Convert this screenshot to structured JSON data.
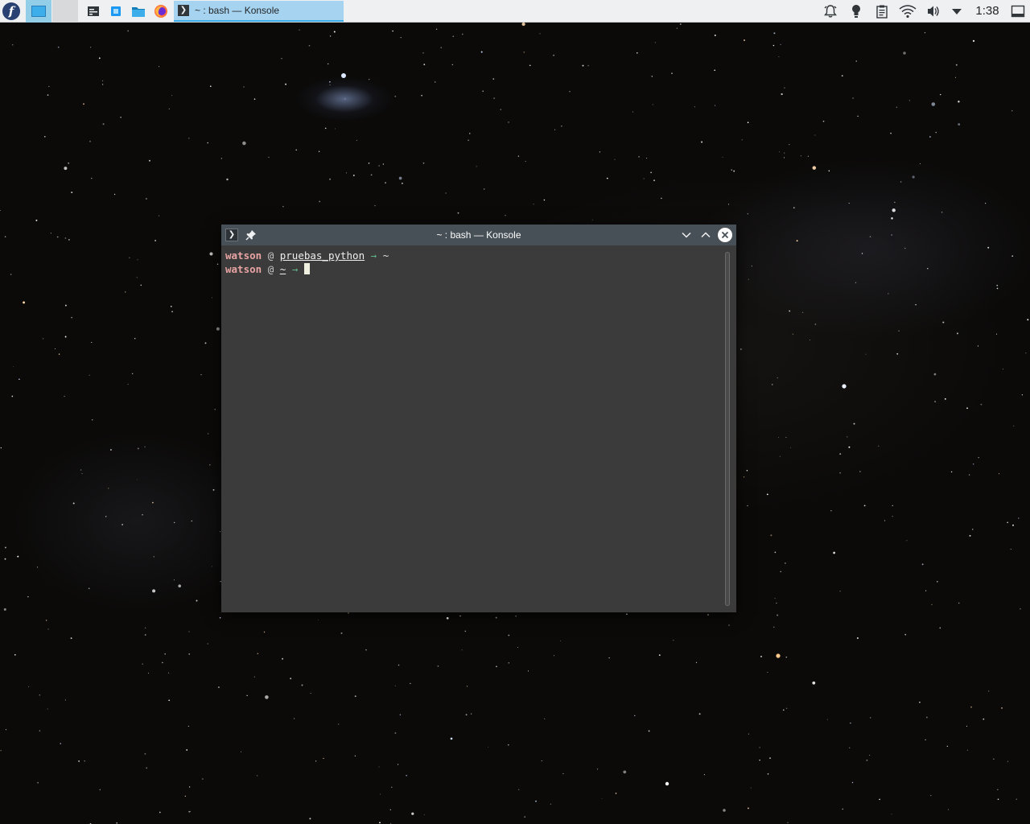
{
  "panel": {
    "launcher_icon": "fedora-logo-icon",
    "launcher_glyph": "f",
    "desktops": [
      {
        "icon": "virtual-desktop-1-icon",
        "active": true
      },
      {
        "icon": "virtual-desktop-2-icon",
        "active": false
      }
    ],
    "quick_launch": [
      {
        "icon": "system-settings-icon"
      },
      {
        "icon": "discover-icon"
      },
      {
        "icon": "dolphin-folder-icon"
      },
      {
        "icon": "firefox-icon"
      }
    ],
    "tasks": [
      {
        "label": "~ : bash — Konsole",
        "icon": "konsole-icon",
        "active": true
      }
    ],
    "tray": [
      {
        "icon": "notifications-bell-icon"
      },
      {
        "icon": "keep-awake-bulb-icon"
      },
      {
        "icon": "clipboard-icon"
      },
      {
        "icon": "wifi-icon"
      },
      {
        "icon": "volume-icon"
      },
      {
        "icon": "expand-tray-arrow-icon"
      }
    ],
    "clock": "1:38",
    "show_desktop_icon": "show-desktop-icon"
  },
  "window": {
    "title": "~ : bash — Konsole",
    "app_icon": "konsole-icon",
    "app_icon_glyph": "❯",
    "buttons": [
      "pin-icon",
      "minimize-icon",
      "maximize-icon",
      "close-icon"
    ],
    "colors": {
      "titlebar": "#475057",
      "terminal_bg": "#3b3b3b",
      "user": "#e8a3a3",
      "arrow": "#60b48a"
    }
  },
  "terminal": {
    "lines": [
      {
        "user": "watson",
        "at": "@",
        "host": "pruebas_python",
        "arrow": "→",
        "cwd": "~"
      },
      {
        "user": "watson",
        "at": "@",
        "host": "~",
        "arrow": "→",
        "cwd": ""
      }
    ]
  }
}
